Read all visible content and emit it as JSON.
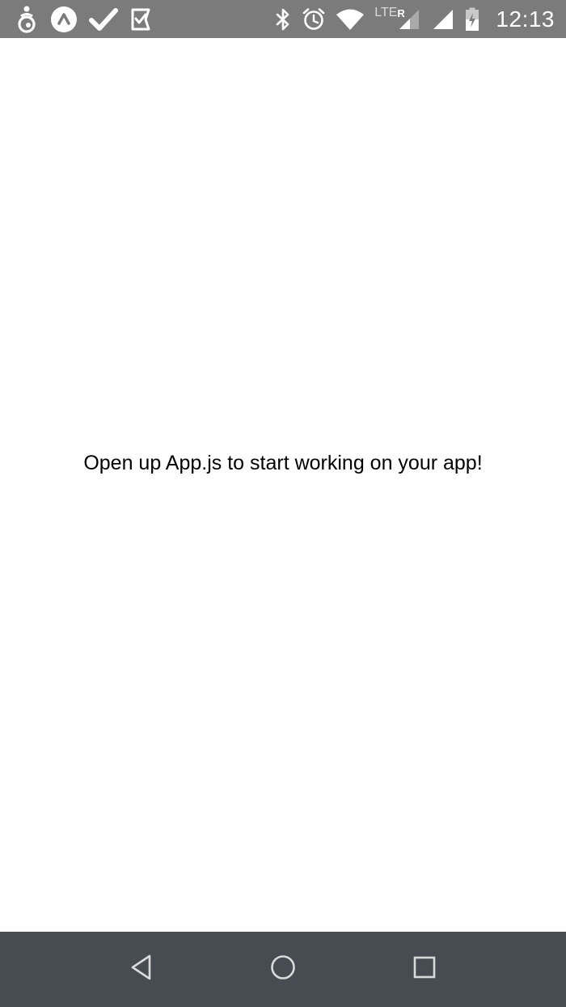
{
  "status_bar": {
    "time": "12:13",
    "network_type": "LTE",
    "roaming_indicator": "R",
    "left_icons": [
      "expo-icon",
      "arrow-up-circle-icon",
      "check-icon",
      "check-flag-icon"
    ],
    "right_icons": [
      "bluetooth-icon",
      "alarm-icon",
      "wifi-icon",
      "cell-signal-roaming-icon",
      "cell-signal-icon",
      "battery-icon"
    ],
    "background_color": "#7b7b7b"
  },
  "main": {
    "message": "Open up App.js to start working on your app!"
  },
  "nav_bar": {
    "buttons": [
      "back-icon",
      "home-icon",
      "recents-icon"
    ],
    "background_color": "#474c52"
  }
}
